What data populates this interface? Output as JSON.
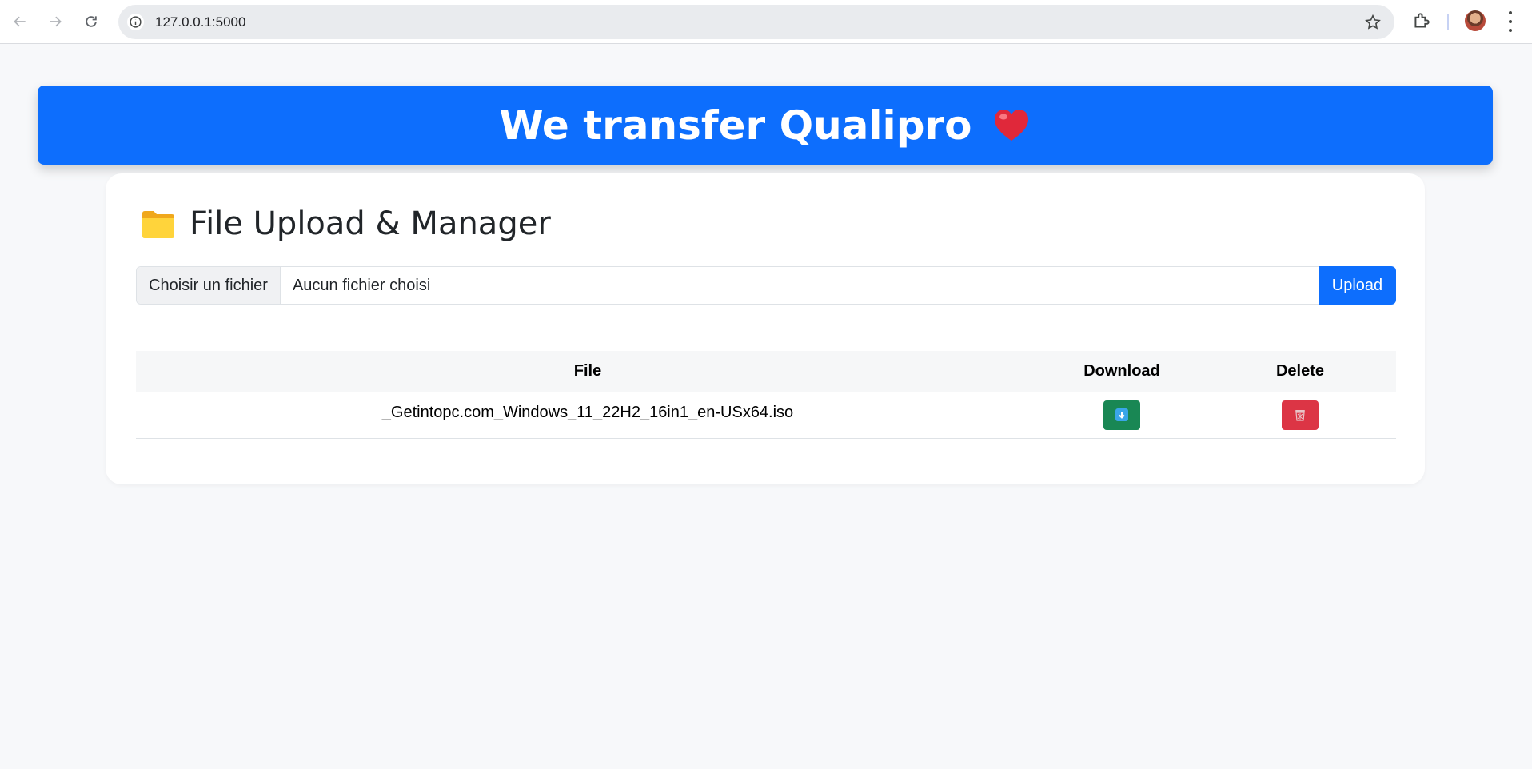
{
  "browser": {
    "url": "127.0.0.1:5000",
    "icons": [
      "back-arrow-icon",
      "forward-arrow-icon",
      "reload-icon",
      "site-info-icon",
      "bookmark-star-icon",
      "extensions-icon",
      "profile-avatar",
      "menu-dots-icon"
    ]
  },
  "header": {
    "title": "We transfer Qualipro",
    "emoji": "❤️"
  },
  "card": {
    "title": "File Upload & Manager",
    "icon": "folder-icon"
  },
  "upload": {
    "choose_label": "Choisir un fichier",
    "no_file_label": "Aucun fichier choisi",
    "button_label": "Upload"
  },
  "table": {
    "columns": [
      "File",
      "Download",
      "Delete"
    ],
    "rows": [
      {
        "file": "_Getintopc.com_Windows_11_22H2_16in1_en-USx64.iso"
      }
    ]
  },
  "colors": {
    "primary": "#0d6efd",
    "success": "#198754",
    "danger": "#dc3545",
    "page_bg": "#f7f8fa"
  }
}
